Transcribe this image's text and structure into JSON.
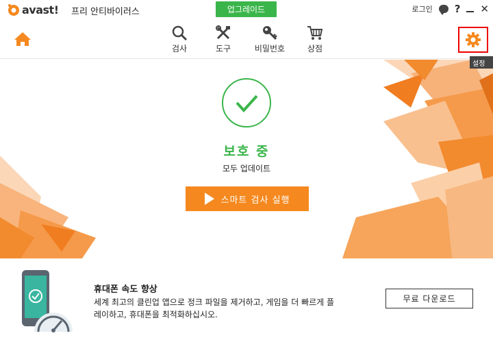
{
  "titlebar": {
    "logo_text": "avast!",
    "product_name": "프리 안티바이러스",
    "upgrade_label": "업그레이드",
    "login_label": "로그인",
    "help_symbol": "?",
    "close_symbol": "✕"
  },
  "nav": {
    "items": [
      {
        "label": "검사",
        "icon": "search-icon"
      },
      {
        "label": "도구",
        "icon": "tools-icon"
      },
      {
        "label": "비밀번호",
        "icon": "key-icon"
      },
      {
        "label": "상점",
        "icon": "cart-icon"
      }
    ],
    "settings_tooltip": "설정"
  },
  "status": {
    "title": "보호 중",
    "subtitle": "모두 업데이트",
    "scan_button": "스마트 검사 실행"
  },
  "promo": {
    "title": "휴대폰 속도 향상",
    "description": "세계 최고의 클린업 앱으로 정크 파일을 제거하고, 게임을 더 빠르게 플레이하고, 휴대폰을 최적화하십시오.",
    "download_button": "무료 다운로드"
  },
  "colors": {
    "accent_orange": "#f5891f",
    "status_green": "#3ab54a",
    "highlight_red": "#ee0000"
  }
}
